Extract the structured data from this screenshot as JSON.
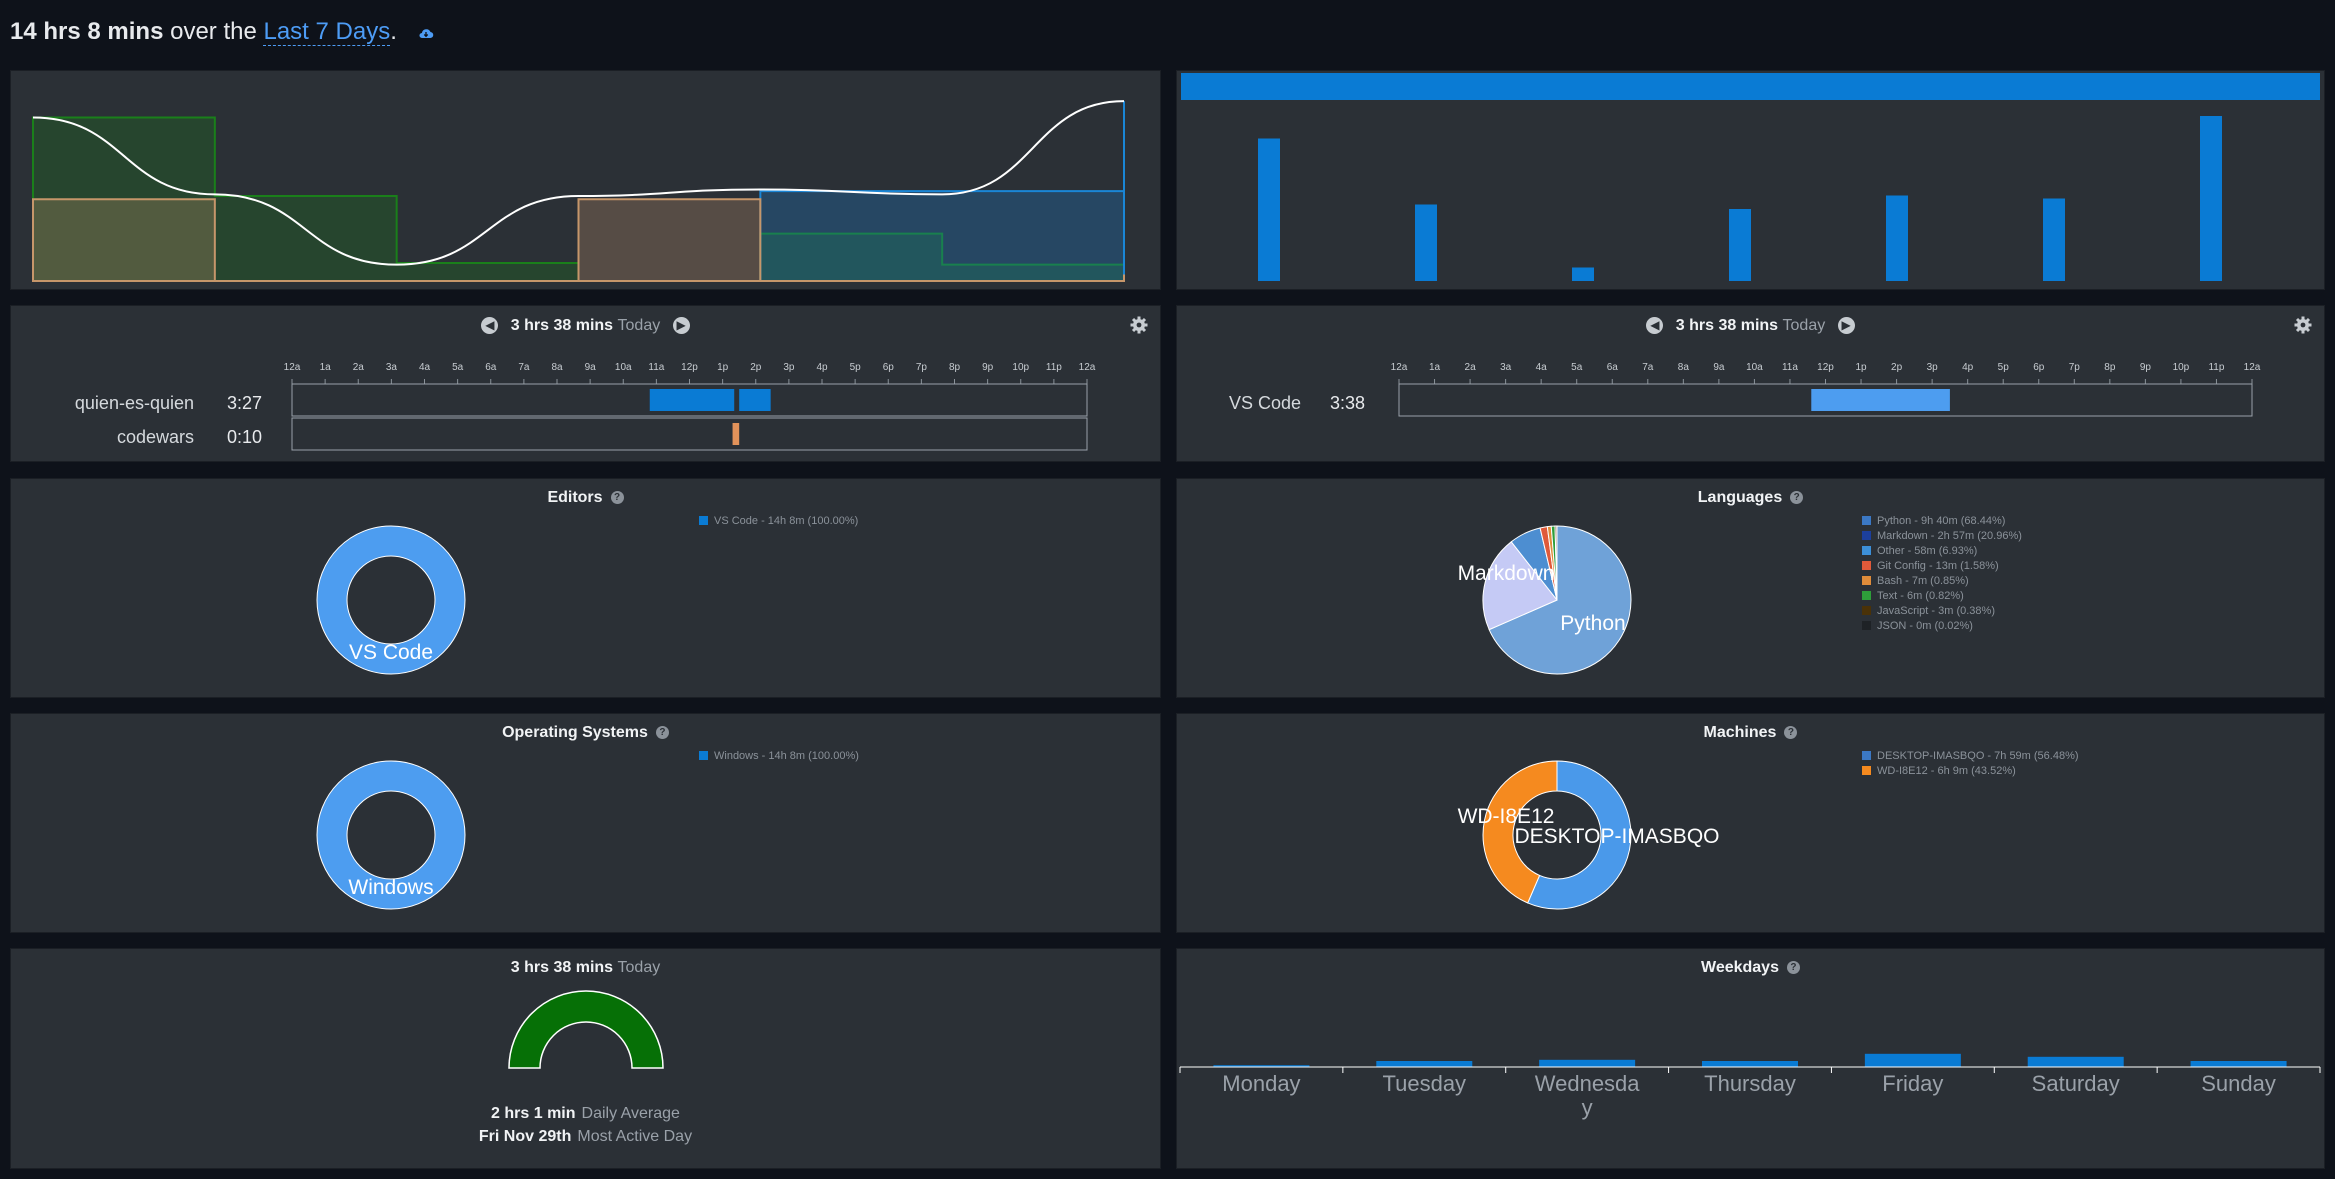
{
  "header": {
    "total": "14 hrs 8 mins",
    "over": "over the",
    "range_label": "Last 7 Days",
    "period": "."
  },
  "activity_chart": {
    "days": 6,
    "series": [
      {
        "name": "green",
        "color": "#1a7f1a",
        "values": [
          10.0,
          5.2,
          1.1,
          0.0,
          2.9,
          1.0,
          0.0
        ]
      },
      {
        "name": "tan",
        "color": "#c6966a",
        "values": [
          5.0,
          0.0,
          0.0,
          5.0,
          0.0,
          0.0,
          0.4
        ]
      },
      {
        "name": "blue",
        "color": "#1a86d6",
        "values": [
          0.0,
          0.0,
          0.0,
          0.0,
          5.5,
          5.5,
          11.0
        ]
      }
    ],
    "line": [
      10,
      5.3,
      1.0,
      5.2,
      5.6,
      5.3,
      11
    ]
  },
  "daily_bars": {
    "values": [
      9.5,
      5.1,
      0.9,
      4.8,
      5.7,
      5.5,
      11.0
    ],
    "max": 11.0
  },
  "timeline": {
    "total": "3 hrs 38 mins",
    "today": "Today",
    "hour_labels": [
      "12a",
      "1a",
      "2a",
      "3a",
      "4a",
      "5a",
      "6a",
      "7a",
      "8a",
      "9a",
      "10a",
      "11a",
      "12p",
      "1p",
      "2p",
      "3p",
      "4p",
      "5p",
      "6p",
      "7p",
      "8p",
      "9p",
      "10p",
      "11p",
      "12a"
    ],
    "projects": [
      {
        "name": "quien-es-quien",
        "time": "3:27",
        "blocks": [
          [
            10.8,
            13.35,
            "#0a7bd4"
          ],
          [
            13.5,
            14.45,
            "#0a7bd4"
          ]
        ]
      },
      {
        "name": "codewars",
        "time": "0:10",
        "blocks": [
          [
            13.3,
            13.5,
            "#e2925a"
          ]
        ]
      }
    ],
    "editors": [
      {
        "name": "VS Code",
        "time": "3:38",
        "blocks": [
          [
            11.6,
            15.5,
            "#4d9df0"
          ]
        ]
      }
    ]
  },
  "editors": {
    "title": "Editors",
    "label": "VS Code",
    "legend": [
      {
        "text": "VS Code - 14h 8m (100.00%)",
        "color": "#0a7bd4"
      }
    ]
  },
  "languages": {
    "title": "Languages",
    "slices": [
      {
        "label": "Python",
        "pct": 68.44,
        "color": "#6fa2d8"
      },
      {
        "label": "Markdown",
        "pct": 20.96,
        "color": "#c5caf5"
      },
      {
        "label": "Other",
        "pct": 6.93,
        "color": "#4d8ed1"
      },
      {
        "label": "Git Config",
        "pct": 1.58,
        "color": "#e05a3a"
      },
      {
        "label": "Bash",
        "pct": 0.85,
        "color": "#e08c3a"
      },
      {
        "label": "Text",
        "pct": 0.82,
        "color": "#2e9e3a"
      },
      {
        "label": "JavaScript",
        "pct": 0.38,
        "color": "#6b4a1a"
      },
      {
        "label": "JSON",
        "pct": 0.02,
        "color": "#2b2b2b"
      }
    ],
    "pie_labels": [
      "Python",
      "Markdown"
    ],
    "legend": [
      {
        "text": "Python - 9h 40m (68.44%)",
        "color": "#3b78c4"
      },
      {
        "text": "Markdown - 2h 57m (20.96%)",
        "color": "#1c3f9c"
      },
      {
        "text": "Other - 58m (6.93%)",
        "color": "#3c8fd8"
      },
      {
        "text": "Git Config - 13m (1.58%)",
        "color": "#e05a3a"
      },
      {
        "text": "Bash - 7m (0.85%)",
        "color": "#e08c3a"
      },
      {
        "text": "Text - 6m (0.82%)",
        "color": "#2e9e3a"
      },
      {
        "text": "JavaScript - 3m (0.38%)",
        "color": "#4a3208"
      },
      {
        "text": "JSON - 0m (0.02%)",
        "color": "#1e2226"
      }
    ]
  },
  "os": {
    "title": "Operating Systems",
    "label": "Windows",
    "legend": [
      {
        "text": "Windows - 14h 8m (100.00%)",
        "color": "#0a7bd4"
      }
    ]
  },
  "machines": {
    "title": "Machines",
    "slices": [
      {
        "label": "DESKTOP-IMASBQO",
        "pct": 56.48,
        "color": "#4a99ea"
      },
      {
        "label": "WD-I8E12",
        "pct": 43.52,
        "color": "#f58a1f"
      }
    ],
    "label_a": "WD-I8E12",
    "label_b": "DESKTOP-IMASBQO",
    "legend": [
      {
        "text": "DESKTOP-IMASBQO - 7h 59m (56.48%)",
        "color": "#3b78c4"
      },
      {
        "text": "WD-I8E12 - 6h 9m (43.52%)",
        "color": "#f58a1f"
      }
    ]
  },
  "goal": {
    "total": "3 hrs 38 mins",
    "today": "Today",
    "progress": 1.0,
    "avg_value": "2 hrs 1 min",
    "avg_label": "Daily Average",
    "active_value": "Fri Nov 29th",
    "active_label": "Most Active Day"
  },
  "weekdays": {
    "title": "Weekdays",
    "days": [
      "Monday",
      "Tuesday",
      "Wednesday",
      "Thursday",
      "Friday",
      "Saturday",
      "Sunday"
    ],
    "values": [
      0.3,
      1.0,
      1.2,
      1.0,
      2.2,
      1.7,
      1.0
    ]
  }
}
